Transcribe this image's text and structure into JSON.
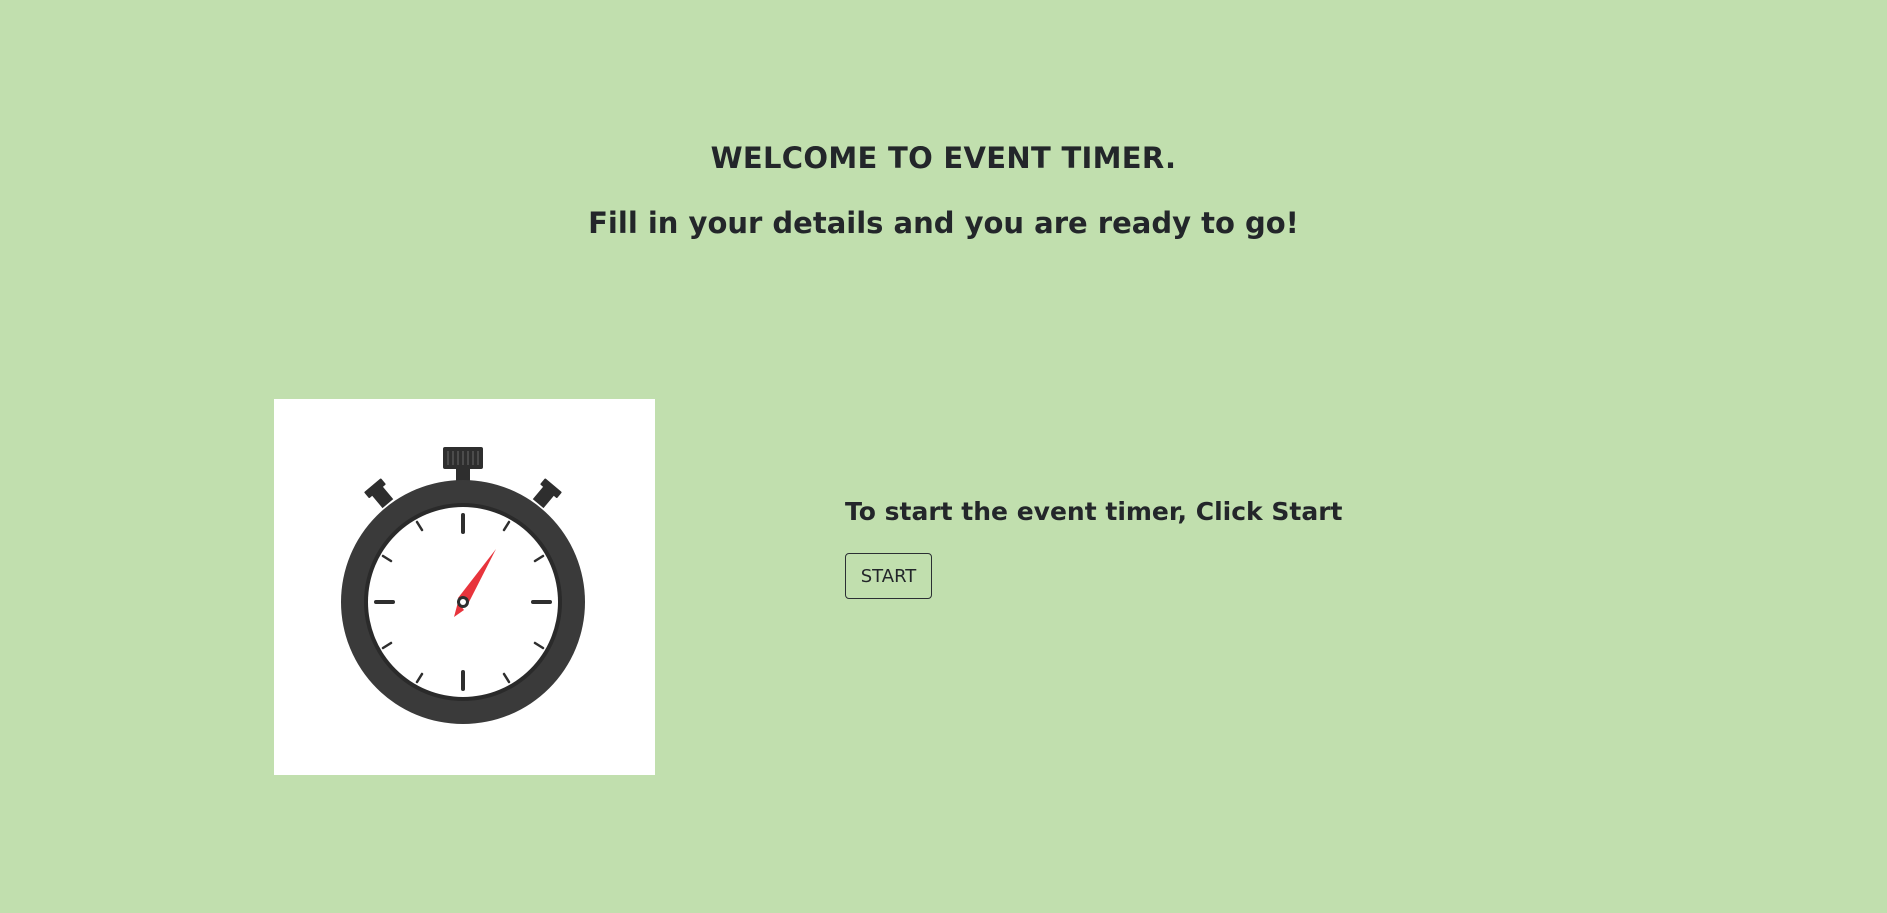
{
  "hero": {
    "title": "WELCOME TO EVENT TIMER.",
    "subtitle": "Fill in your details and you are ready to go!"
  },
  "illustration": {
    "icon": "stopwatch-icon",
    "colors": {
      "body": "#3a3a3a",
      "face": "#ffffff",
      "hand": "#e8343c"
    }
  },
  "cta": {
    "text": "To start the event timer, Click Start",
    "button_label": "START"
  },
  "theme": {
    "background": "#c1dfae",
    "text": "#23262a"
  }
}
